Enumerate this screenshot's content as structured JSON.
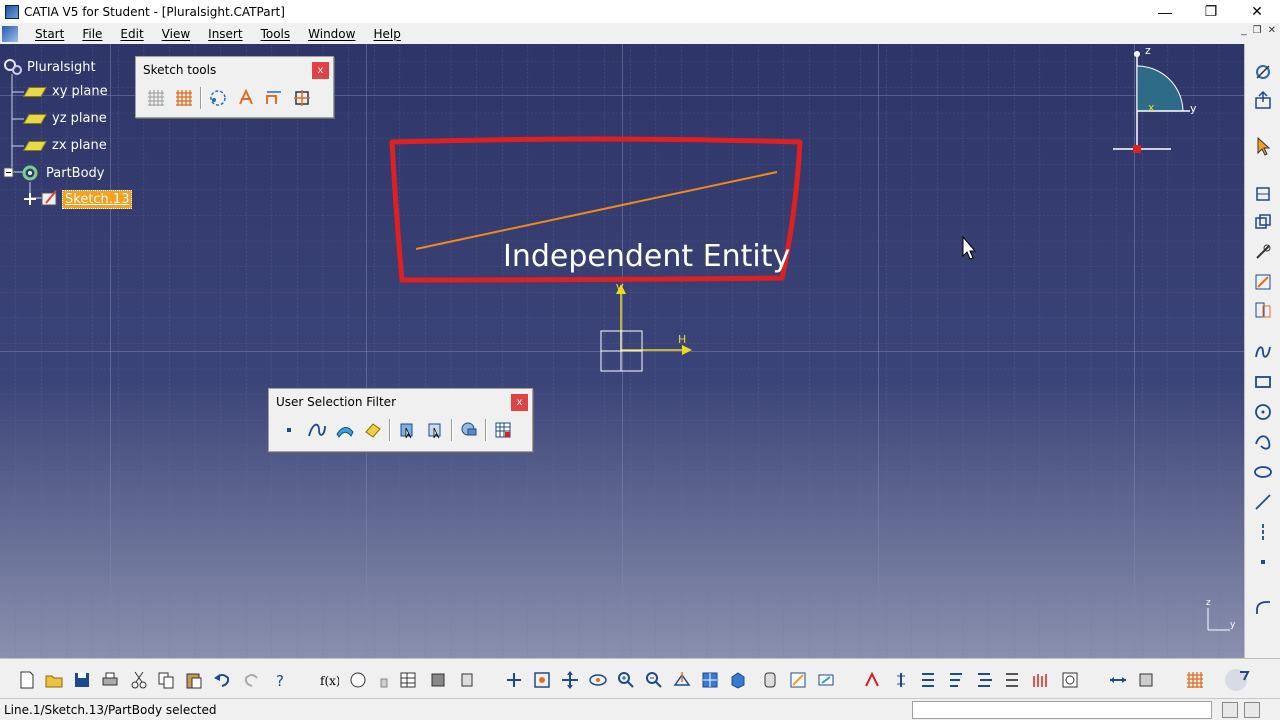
{
  "window": {
    "title": "CATIA V5 for Student - [Pluralsight.CATPart]",
    "minimize": "—",
    "maximize": "❐",
    "close": "✕"
  },
  "menu": {
    "items": [
      "Start",
      "File",
      "Edit",
      "View",
      "Insert",
      "Tools",
      "Window",
      "Help"
    ],
    "mdi_minimize": "_",
    "mdi_restore": "❐",
    "mdi_close": "✕"
  },
  "tree": {
    "root": "Pluralsight",
    "xy_plane": "xy plane",
    "yz_plane": "yz plane",
    "zx_plane": "zx plane",
    "part_body": "PartBody",
    "sketch": "Sketch.13"
  },
  "sketch_tools": {
    "title": "Sketch tools",
    "close": "x",
    "icons": [
      "grid-icon",
      "snap-to-point-icon",
      "construction-elements-icon",
      "geometrical-constraints-icon",
      "dimensional-constraints-icon",
      "automatic-constraints-icon"
    ]
  },
  "user_selection_filter": {
    "title": "User Selection Filter",
    "close": "x",
    "icons": [
      "point-filter-icon",
      "curve-filter-icon",
      "surface-filter-icon",
      "volume-filter-icon",
      "feature-element-filter-icon",
      "geometrical-element-filter-icon",
      "intersection-edge-icon",
      "tool-selection-icon"
    ]
  },
  "overlay": {
    "text": "Independent Entity",
    "frame_color": "#e02020",
    "line_color": "#f08a1a"
  },
  "sketch_axes": {
    "v_label": "V",
    "h_label": "H",
    "color": "#f0d820"
  },
  "compass": {
    "z": "z",
    "y": "y",
    "x": "x"
  },
  "mini_axes": {
    "z": "z",
    "y": "y"
  },
  "status": {
    "text": "Line.1/Sketch.13/PartBody selected"
  },
  "colors": {
    "viewport_top": "#2e3568",
    "viewport_bottom": "#8a90ae",
    "selection": "#f5a020"
  }
}
